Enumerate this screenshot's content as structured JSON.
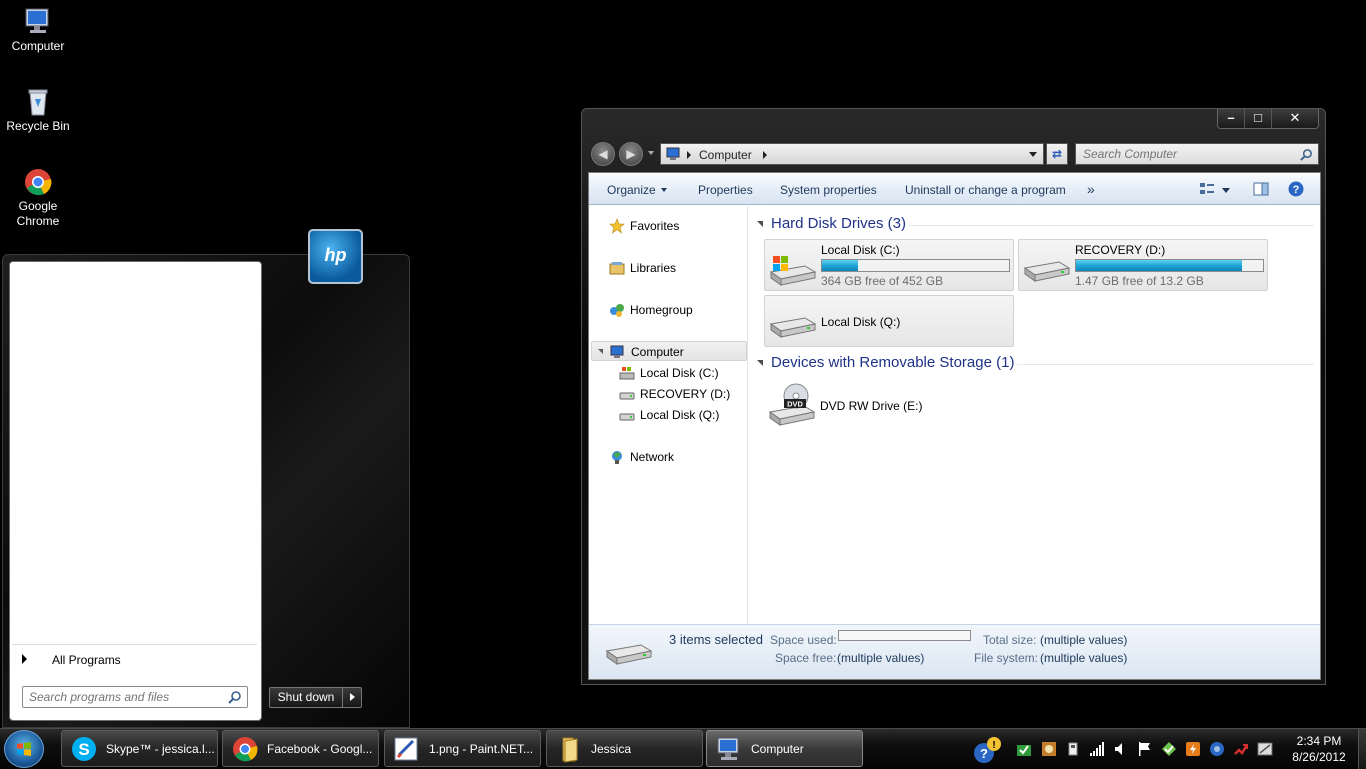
{
  "desktop": {
    "icons": [
      {
        "label": "Computer"
      },
      {
        "label": "Recycle Bin"
      },
      {
        "label": "Google Chrome"
      }
    ]
  },
  "start_menu": {
    "all_programs": "All Programs",
    "search_placeholder": "Search programs and files",
    "shutdown_label": "Shut down",
    "logo_text": "hp"
  },
  "explorer": {
    "caption_buttons": {
      "minimize": "–",
      "maximize": "□",
      "close": "✕"
    },
    "address": {
      "crumb": "Computer"
    },
    "search_placeholder": "Search Computer",
    "commands": {
      "organize": "Organize",
      "properties": "Properties",
      "system_properties": "System properties",
      "uninstall": "Uninstall or change a program",
      "more": "»"
    },
    "nav": {
      "favorites": "Favorites",
      "libraries": "Libraries",
      "homegroup": "Homegroup",
      "computer": "Computer",
      "drive_c": "Local Disk (C:)",
      "drive_d": "RECOVERY (D:)",
      "drive_q": "Local Disk (Q:)",
      "network": "Network"
    },
    "groups": {
      "hard_disks": "Hard Disk Drives (3)",
      "removable": "Devices with Removable Storage (1)"
    },
    "drives": {
      "c": {
        "name": "Local Disk (C:)",
        "free_text": "364 GB free of 452 GB",
        "used_fraction": 0.19
      },
      "d": {
        "name": "RECOVERY (D:)",
        "free_text": "1.47 GB free of 13.2 GB",
        "used_fraction": 0.89
      },
      "q": {
        "name": "Local Disk (Q:)"
      },
      "e": {
        "name": "DVD RW Drive (E:)",
        "badge": "DVD"
      }
    },
    "details": {
      "selected": "3 items selected",
      "space_used_label": "Space used:",
      "space_free_label": "Space free:",
      "space_free_value": "(multiple values)",
      "total_size_label": "Total size:",
      "total_size_value": "(multiple values)",
      "file_system_label": "File system:",
      "file_system_value": "(multiple values)"
    }
  },
  "taskbar": {
    "buttons": [
      {
        "label": "Skype™ - jessica.l..."
      },
      {
        "label": "Facebook - Googl..."
      },
      {
        "label": "1.png - Paint.NET..."
      },
      {
        "label": "Jessica"
      },
      {
        "label": "Computer"
      }
    ],
    "clock": {
      "time": "2:34 PM",
      "date": "8/26/2012"
    }
  },
  "colors": {
    "link_blue": "#1e3287",
    "bar_fill": "#1ea5d6"
  }
}
